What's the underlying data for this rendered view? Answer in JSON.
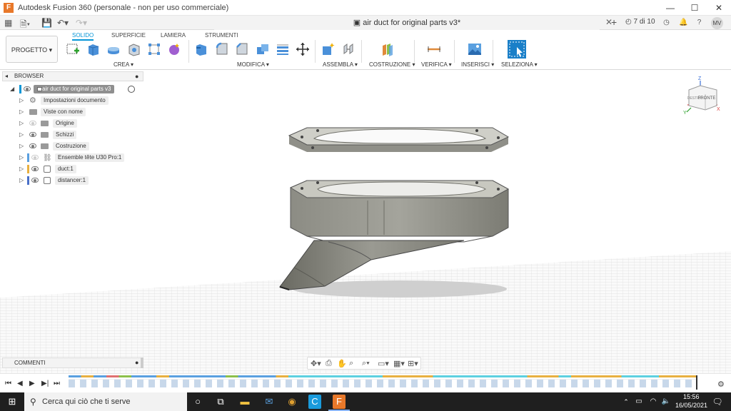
{
  "window": {
    "title": "Autodesk Fusion 360 (personale - non per uso commerciale)",
    "logo_letter": "F",
    "minimize": "—",
    "maximize": "☐",
    "close": "✕"
  },
  "tabs": {
    "document_name": "air duct for original parts v3*",
    "close": "✕",
    "add": "+",
    "job_status": "7 di 10",
    "avatar_initials": "MV"
  },
  "toolbar": {
    "progetto_label": "PROGETTO ▾",
    "workspace_tabs": [
      "SOLIDO",
      "SUPERFICIE",
      "LAMIERA",
      "STRUMENTI"
    ],
    "groups": [
      "CREA ▾",
      "MODIFICA ▾",
      "ASSEMBLA ▾",
      "COSTRUZIONE ▾",
      "VERIFICA ▾",
      "INSERISCI ▾",
      "SELEZIONA ▾"
    ]
  },
  "browser": {
    "header": "BROWSER",
    "root": "air duct for original parts v3",
    "items": [
      {
        "label": "Impostazioni documento",
        "icon": "gear-icon"
      },
      {
        "label": "Viste con nome",
        "icon": "folder-icon"
      },
      {
        "label": "Origine",
        "icon": "folder-icon"
      },
      {
        "label": "Schizzi",
        "icon": "folder-icon"
      },
      {
        "label": "Costruzione",
        "icon": "folder-icon"
      },
      {
        "label": "Ensemble tête U30 Pro:1",
        "icon": "link-icon"
      },
      {
        "label": "duct:1",
        "icon": "component-icon"
      },
      {
        "label": "distancer:1",
        "icon": "component-icon"
      }
    ]
  },
  "viewcube": {
    "face": "FRONTE",
    "side": "DESTRA",
    "axis_z": "Z",
    "axis_x": "X",
    "axis_y": "Y"
  },
  "comments": {
    "label": "COMMENTI"
  },
  "taskbar": {
    "search_placeholder": "Cerca qui ciò che ti serve",
    "time": "15:56",
    "date": "16/05/2021"
  },
  "colors": {
    "accent": "#0696d7",
    "taskbar": "#1f1f1f",
    "model_gray": "#9a9a92"
  }
}
